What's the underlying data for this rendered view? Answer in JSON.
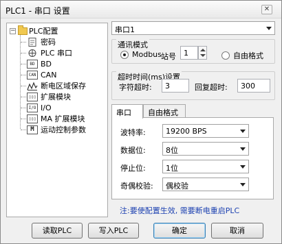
{
  "window": {
    "title": "PLC1 - 串口 设置",
    "close_glyph": "✕"
  },
  "tree": {
    "root": {
      "label": "PLC配置",
      "expander": "−"
    },
    "items": [
      {
        "label": "密码",
        "icon": "password-doc-icon",
        "icon_text": ""
      },
      {
        "label": "PLC 串口",
        "icon": "serial-port-icon",
        "icon_text": "⊕"
      },
      {
        "label": "BD",
        "icon": "bd-board-icon",
        "icon_text": "BD"
      },
      {
        "label": "CAN",
        "icon": "can-bus-icon",
        "icon_text": "CAN"
      },
      {
        "label": "断电区域保存",
        "icon": "power-off-retain-icon",
        "icon_text": "⚡"
      },
      {
        "label": "扩展模块",
        "icon": "expansion-module-icon",
        "icon_text": "▯▯▯"
      },
      {
        "label": "I/O",
        "icon": "io-icon",
        "icon_text": "I/O"
      },
      {
        "label": "MA 扩展模块",
        "icon": "ma-expansion-icon",
        "icon_text": "▯▯▯"
      },
      {
        "label": "运动控制参数",
        "icon": "motion-control-icon",
        "icon_text": "M"
      }
    ]
  },
  "port_select": {
    "value": "串口1"
  },
  "comm_mode": {
    "title": "通讯模式",
    "modbus_label": "Modbus",
    "station_label": "站号",
    "station_value": "1",
    "free_format_label": "自由格式",
    "selected": "modbus"
  },
  "timeout": {
    "title": "超时时间(ms)设置",
    "char_label": "字符超时:",
    "char_value": "3",
    "reply_label": "回复超时:",
    "reply_value": "300"
  },
  "tabs": [
    {
      "label": "串口",
      "active": true
    },
    {
      "label": "自由格式",
      "active": false
    }
  ],
  "serial": {
    "baud_label": "波特率:",
    "baud_value": "19200 BPS",
    "databits_label": "数据位:",
    "databits_value": "8位",
    "stopbits_label": "停止位:",
    "stopbits_value": "1位",
    "parity_label": "奇偶校验:",
    "parity_value": "偶校验"
  },
  "note": "注:要使配置生效, 需要断电重启PLC",
  "buttons": {
    "read_plc": "读取PLC",
    "write_plc": "写入PLC",
    "ok": "确定",
    "cancel": "取消"
  },
  "colors": {
    "note_text": "#1a3fb0",
    "default_button_border": "#3c7fb1"
  }
}
